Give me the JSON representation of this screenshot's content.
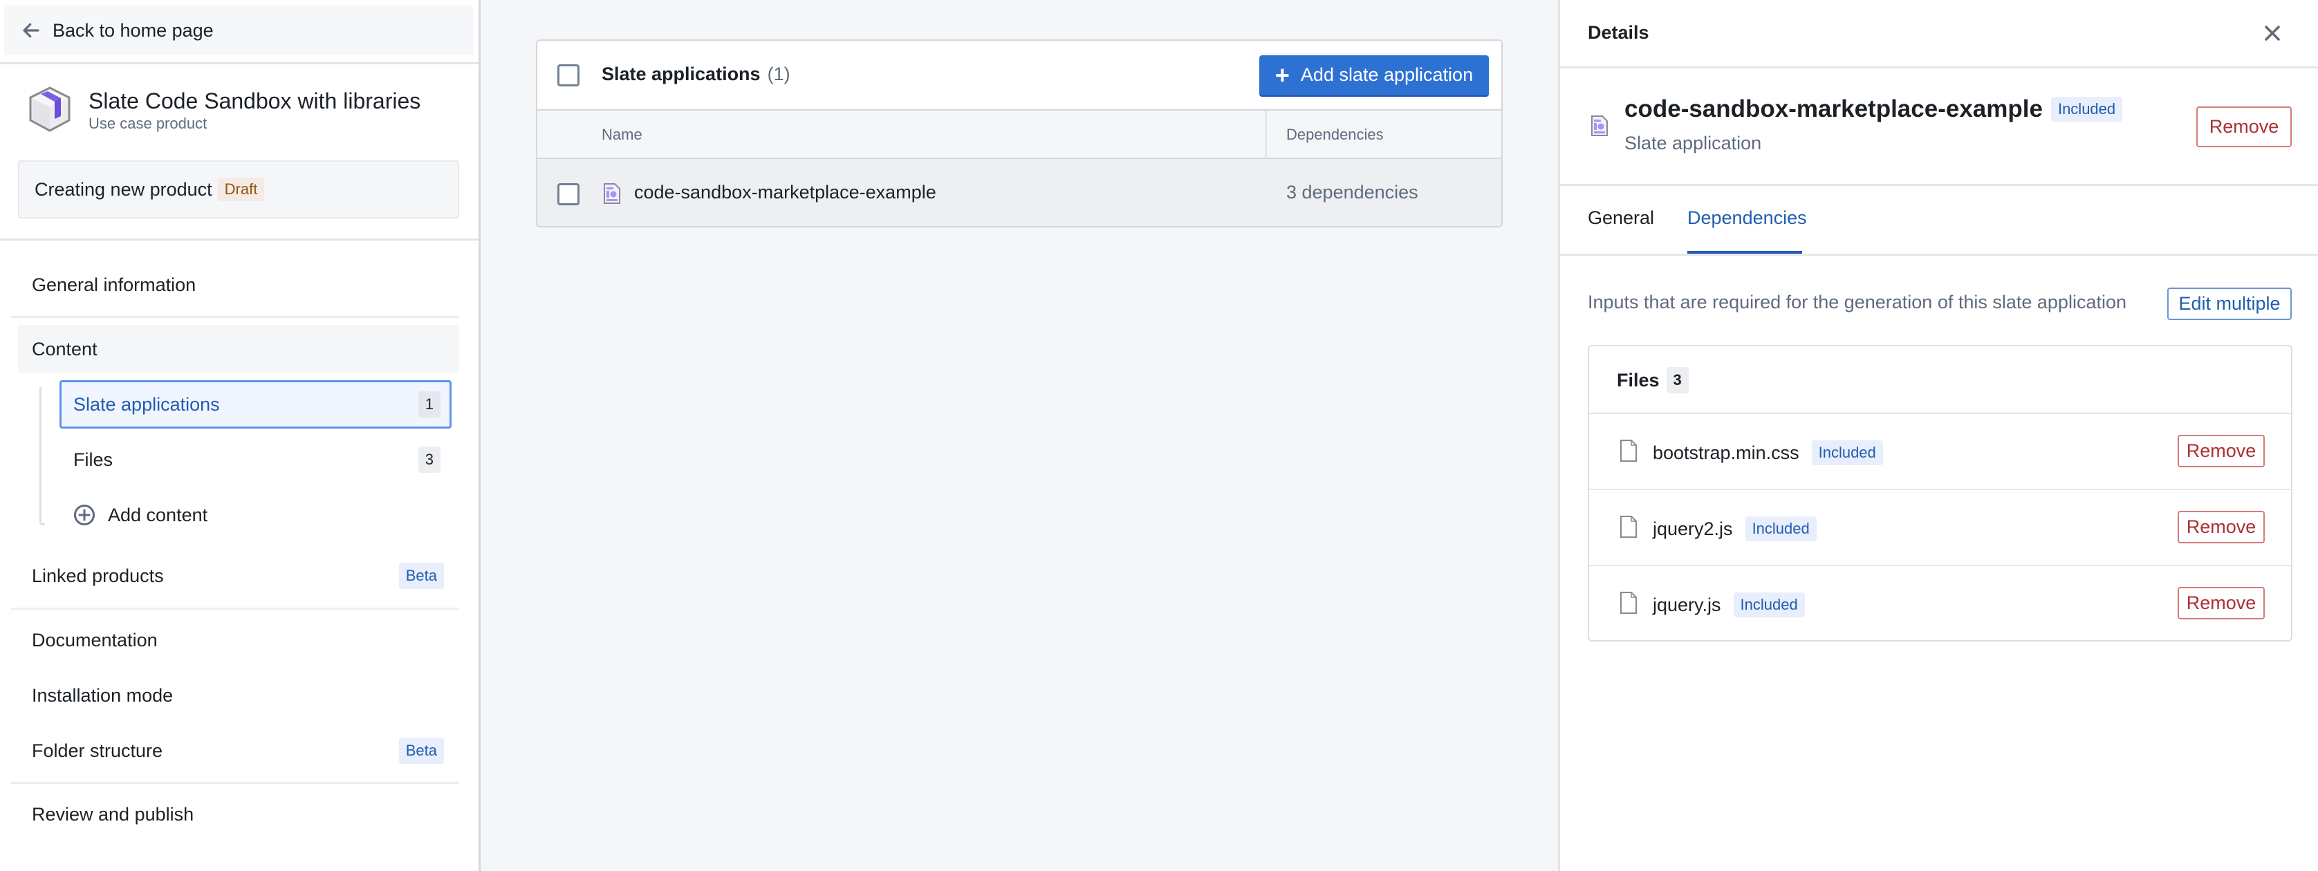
{
  "sidebar": {
    "back_label": "Back to home page",
    "product": {
      "title": "Slate Code Sandbox with libraries",
      "subtitle": "Use case product"
    },
    "status": {
      "text": "Creating new product",
      "badge": "Draft"
    },
    "nav": {
      "general_information": "General information",
      "content": "Content",
      "content_items": [
        {
          "label": "Slate applications",
          "count": "1",
          "selected": true
        },
        {
          "label": "Files",
          "count": "3",
          "selected": false
        }
      ],
      "add_content": "Add content",
      "linked_products": "Linked products",
      "linked_products_badge": "Beta",
      "documentation": "Documentation",
      "installation_mode": "Installation mode",
      "folder_structure": "Folder structure",
      "folder_structure_badge": "Beta",
      "review_and_publish": "Review and publish"
    }
  },
  "table": {
    "title": "Slate applications",
    "count": "(1)",
    "add_button": "Add slate application",
    "columns": [
      "Name",
      "Dependencies"
    ],
    "rows": [
      {
        "name": "code-sandbox-marketplace-example",
        "dependencies": "3 dependencies"
      }
    ]
  },
  "details": {
    "header": "Details",
    "name": "code-sandbox-marketplace-example",
    "badge": "Included",
    "type": "Slate application",
    "remove_label": "Remove",
    "tabs": [
      {
        "label": "General",
        "active": false
      },
      {
        "label": "Dependencies",
        "active": true
      }
    ],
    "description": "Inputs that are required for the generation of this slate application",
    "edit_multiple": "Edit multiple",
    "files": {
      "title": "Files",
      "count": "3",
      "items": [
        {
          "name": "bootstrap.min.css",
          "badge": "Included",
          "action": "Remove"
        },
        {
          "name": "jquery2.js",
          "badge": "Included",
          "action": "Remove"
        },
        {
          "name": "jquery.js",
          "badge": "Included",
          "action": "Remove"
        }
      ]
    }
  },
  "colors": {
    "primary": "#2d72d2",
    "primary_text": "#215db0",
    "danger": "#ac2f33",
    "draft_text": "#935610",
    "icon_purple": "#9d87f0"
  }
}
